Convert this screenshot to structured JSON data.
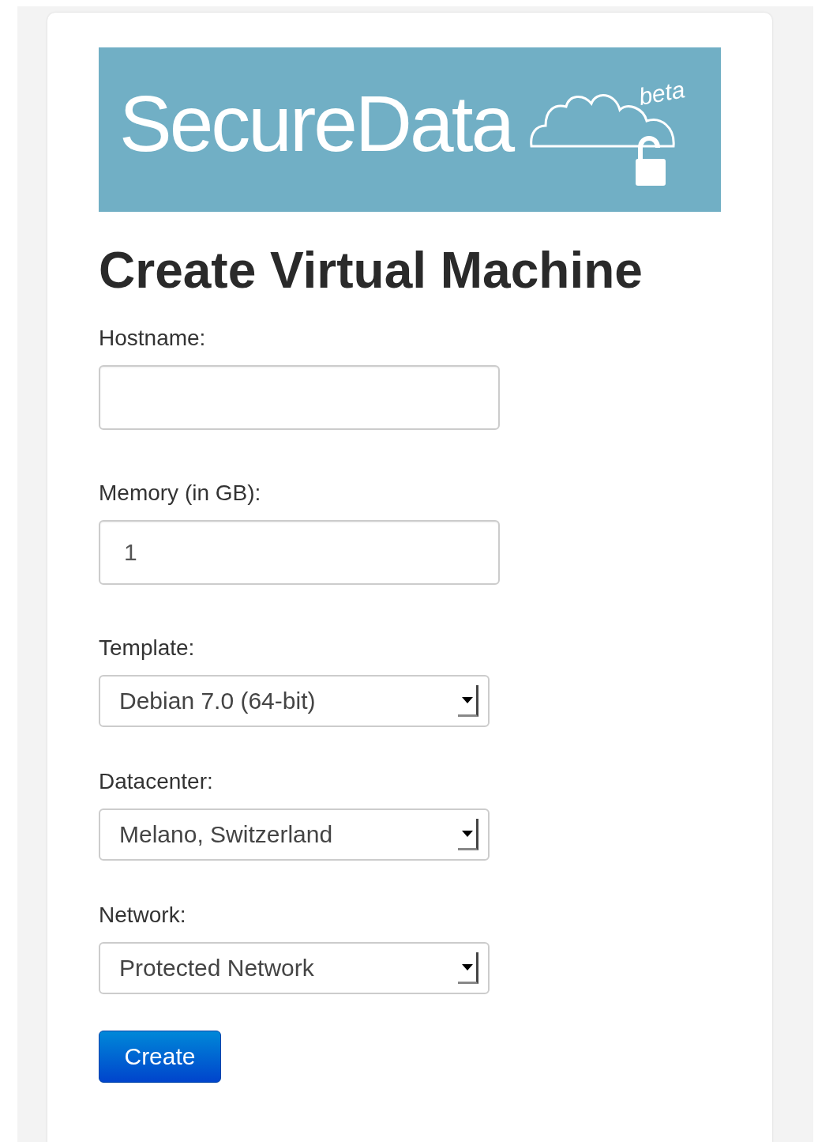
{
  "logo": {
    "name": "SecureData",
    "badge": "beta"
  },
  "title": "Create Virtual Machine",
  "fields": [
    {
      "label": "Hostname:",
      "kind": "text"
    },
    {
      "label": "Memory (in GB):",
      "kind": "text",
      "value": "1"
    },
    {
      "label": "Template:",
      "kind": "select",
      "value": "Debian 7.0 (64-bit)"
    },
    {
      "label": "Datacenter:",
      "kind": "select",
      "value": "Melano, Switzerland"
    },
    {
      "label": "Network:",
      "kind": "select",
      "value": "Protected Network"
    }
  ],
  "submit": "Create"
}
